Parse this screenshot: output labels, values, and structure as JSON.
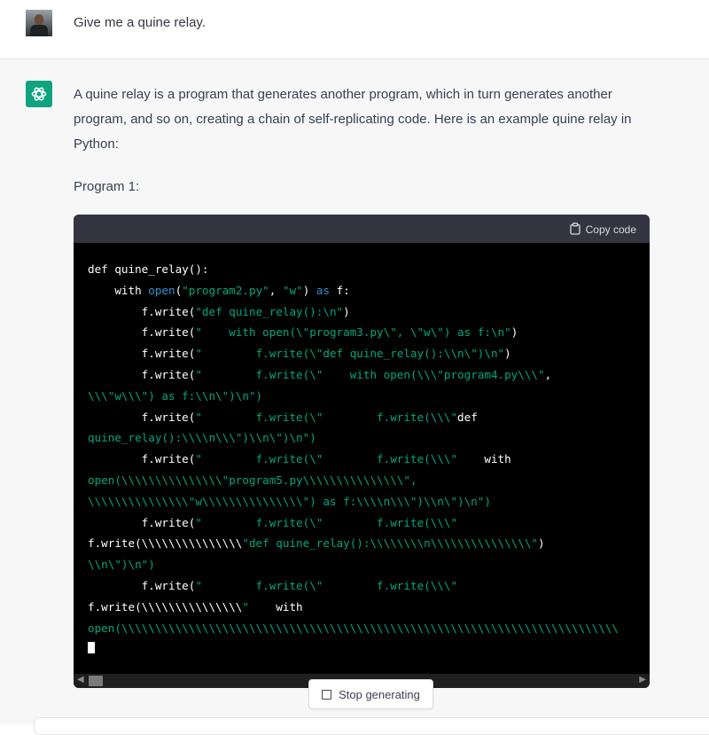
{
  "user_message": {
    "text": "Give me a quine relay."
  },
  "assistant_message": {
    "intro": "A quine relay is a program that generates another program, which in turn generates another program, and so on, creating a chain of self-replicating code. Here is an example quine relay in Python:",
    "program_label": "Program 1:",
    "code_block": {
      "copy_label": "Copy code",
      "lines": [
        "def quine_relay():",
        "    with open(\"program2.py\", \"w\") as f:",
        "        f.write(\"def quine_relay():\\n\")",
        "        f.write(\"    with open(\\\"program3.py\\\", \\\"w\\\") as f:\\n\")",
        "        f.write(\"        f.write(\\\"def quine_relay():\\\\n\\\")\\n\")",
        "        f.write(\"        f.write(\\\"    with open(\\\\\\\"program4.py\\\\\\\",",
        "\\\\\\\"w\\\\\\\") as f:\\\\n\\\")\\n\")",
        "        f.write(\"        f.write(\\\"        f.write(\\\\\\\"def",
        "quine_relay():\\\\\\\\n\\\\\\\")\\\\n\\\")\\n\")",
        "        f.write(\"        f.write(\\\"        f.write(\\\\\\\"    with",
        "open(\\\\\\\\\\\\\\\\\\\\\\\\\\\\\\\"program5.py\\\\\\\\\\\\\\\\\\\\\\\\\\\\\\\",",
        "\\\\\\\\\\\\\\\\\\\\\\\\\\\\\\\"w\\\\\\\\\\\\\\\\\\\\\\\\\\\\\\\") as f:\\\\\\\\n\\\\\\\")\\\\n\\\")\\n\")",
        "        f.write(\"        f.write(\\\"        f.write(\\\\\\\"",
        "f.write(\\\\\\\\\\\\\\\\\\\\\\\\\\\\\\\"def quine_relay():\\\\\\\\\\\\\\\\n\\\\\\\\\\\\\\\\\\\\\\\\\\\\\\\")",
        "\\\\n\\\")\\n\")",
        "        f.write(\"        f.write(\\\"        f.write(\\\\\\\"",
        "f.write(\\\\\\\\\\\\\\\\\\\\\\\\\\\\\\\"    with",
        "open(\\\\\\\\\\\\\\\\\\\\\\\\\\\\\\\\\\\\\\\\\\\\\\\\\\\\\\\\\\\\\\\\\\\\\\\\\\\\\\\\\\\\\\\\\\\\\\\\\\\\\\\\\\\\\\\\\\\\\\\\\\\\\\\\\\\\\\\\\\\\\\\\\\\\"
      ]
    }
  },
  "stop_button": {
    "label": "Stop generating"
  },
  "colors": {
    "accent": "#10a37f",
    "code_string": "#00a67d",
    "code_builtin": "#2e95d3",
    "code_background": "#000000",
    "code_header": "#343541"
  },
  "icons": {
    "user_avatar": "user-photo",
    "assistant_avatar": "openai-logo-icon",
    "copy": "clipboard-icon",
    "stop": "square-icon"
  }
}
